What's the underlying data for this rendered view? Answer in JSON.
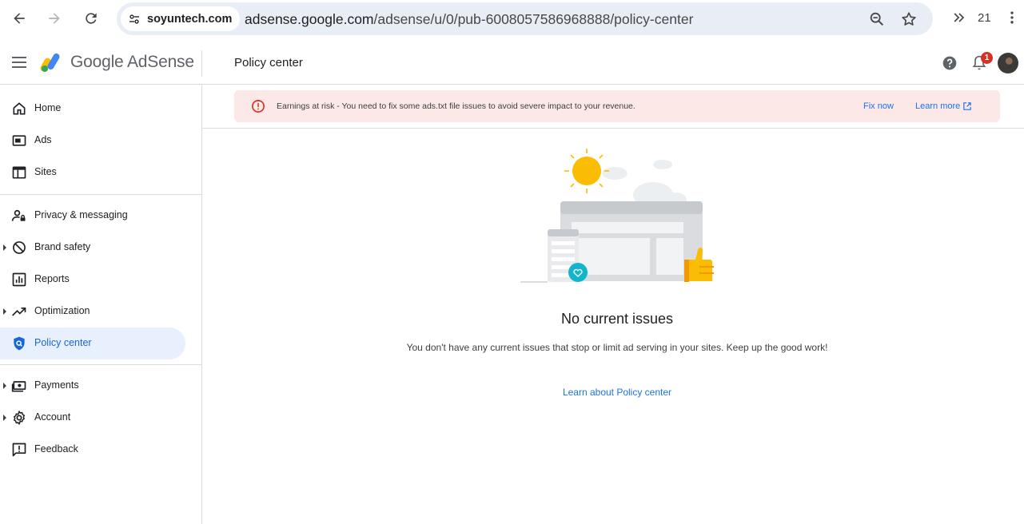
{
  "browser": {
    "site_chip": "soyuntech.com",
    "url_host": "adsense.google.com",
    "url_path": "/adsense/u/0/pub-6008057586968888/policy-center",
    "tab_count": "21"
  },
  "header": {
    "logo_text": "Google AdSense",
    "page_title": "Policy center",
    "notification_count": "1"
  },
  "sidebar": {
    "items": [
      {
        "label": "Home",
        "icon": "home-icon"
      },
      {
        "label": "Ads",
        "icon": "ads-icon"
      },
      {
        "label": "Sites",
        "icon": "sites-icon"
      },
      {
        "label": "Privacy & messaging",
        "icon": "privacy-icon"
      },
      {
        "label": "Brand safety",
        "icon": "brand-safety-icon"
      },
      {
        "label": "Reports",
        "icon": "reports-icon"
      },
      {
        "label": "Optimization",
        "icon": "optimization-icon"
      },
      {
        "label": "Policy center",
        "icon": "policy-shield-icon",
        "active": true
      },
      {
        "label": "Payments",
        "icon": "payments-icon"
      },
      {
        "label": "Account",
        "icon": "gear-icon"
      },
      {
        "label": "Feedback",
        "icon": "feedback-icon"
      }
    ]
  },
  "alert": {
    "text": "Earnings at risk - You need to fix some ads.txt file issues to avoid severe impact to your revenue.",
    "fix_label": "Fix now",
    "learn_label": "Learn more"
  },
  "empty_state": {
    "title": "No current issues",
    "description": "You don't have any current issues that stop or limit ad serving in your sites. Keep up the good work!",
    "link": "Learn about Policy center"
  },
  "colors": {
    "accent": "#1a73e8",
    "active_nav_bg": "#e8f0fe",
    "alert_bg": "#fce8e6",
    "alert_icon": "#d93025"
  }
}
